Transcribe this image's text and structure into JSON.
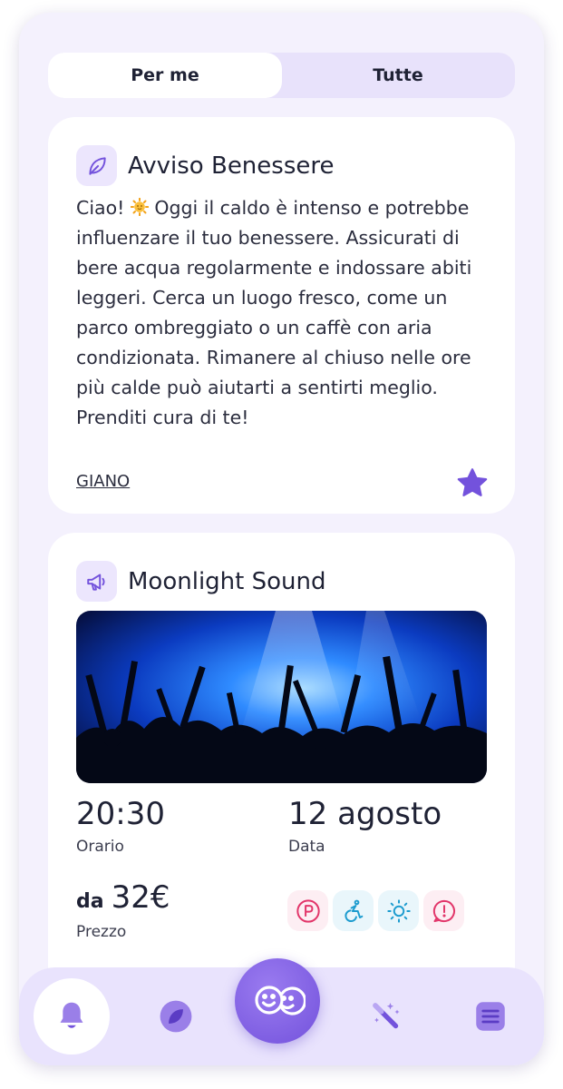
{
  "tabs": {
    "for_me": "Per me",
    "all": "Tutte",
    "active": "for_me"
  },
  "wellness_card": {
    "title": "Avviso Benessere",
    "text_before_emoji": "Ciao! ",
    "text_after_emoji": " Oggi il caldo è intenso e potrebbe influenzare il tuo benessere. Assicurati di bere acqua regolarmente e indossare abiti leggeri. Cerca un luogo fresco, come un parco ombreggiato o un caffè con aria condizionata. Rimanere al chiuso nelle ore più calde può aiutarti a sentirti meglio. Prenditi cura di te!",
    "author": "GIANO",
    "icon": "leaf-icon",
    "action_icon": "star-icon"
  },
  "event_card": {
    "title": "Moonlight Sound",
    "icon": "megaphone-icon",
    "image": "concert-crowd-image",
    "time_value": "20:30",
    "time_label": "Orario",
    "date_value": "12 agosto",
    "date_label": "Data",
    "price_prefix": "da",
    "price_value": "32€",
    "price_label": "Prezzo",
    "amenities": [
      "parking-icon",
      "accessibility-icon",
      "sun-icon",
      "alert-icon"
    ]
  },
  "bottom_nav": {
    "items": [
      "bell-icon",
      "explore-icon",
      "faces-icon",
      "magic-wand-icon",
      "menu-icon"
    ],
    "active": "bell-icon"
  },
  "colors": {
    "accent": "#7352dc",
    "background": "#f4f1fd",
    "icon_bg": "#ece6fd",
    "amenity_pink": "#e2366a",
    "amenity_blue": "#1d9ccf"
  }
}
